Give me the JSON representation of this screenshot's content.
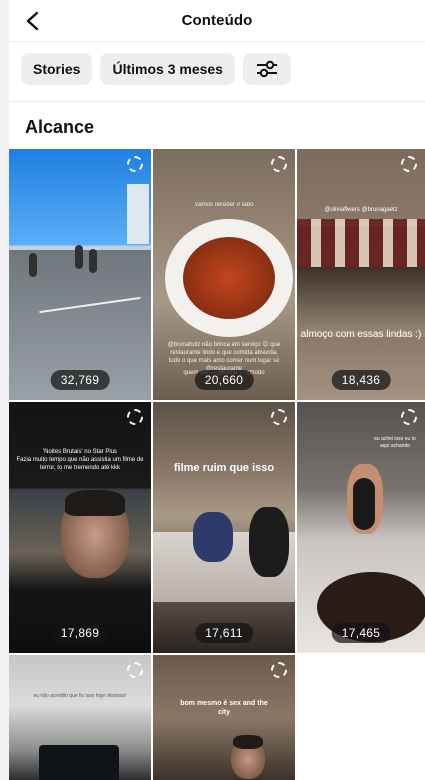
{
  "header": {
    "title": "Conteúdo"
  },
  "filters": {
    "chip_stories": "Stories",
    "chip_period": "Últimos 3 meses"
  },
  "section": {
    "title": "Alcance"
  },
  "tiles": [
    {
      "count": "32,769"
    },
    {
      "count": "20,660",
      "small_top": "Vamos receber o Iabo",
      "small_mid": "@brunaholz não brinca em serviço 😊 que restaurante lindo e que comida absurda, tudo o que mais amo comer num lugar só @restaurante",
      "small_bot": "quem viu — @hvina — @todo"
    },
    {
      "count": "18,436",
      "handles": "@oliviaflwers @brunagaetz",
      "caption": "almoço com essas lindas :)"
    },
    {
      "count": "17,869",
      "sub": "'Noites Brutais' no Star Plus\nFazia muito tempo que não assistia um filme de terror, to me tremendo até kkk"
    },
    {
      "count": "17,611",
      "caption": "filme ruim que isso"
    },
    {
      "count": "17,465",
      "sub": "eu achei isso eu to aqui achando"
    },
    {
      "sub": "eu não acredito que fiz isso hoje vitorioso!"
    },
    {
      "caption": "bom mesmo é sex and the city"
    },
    {}
  ]
}
